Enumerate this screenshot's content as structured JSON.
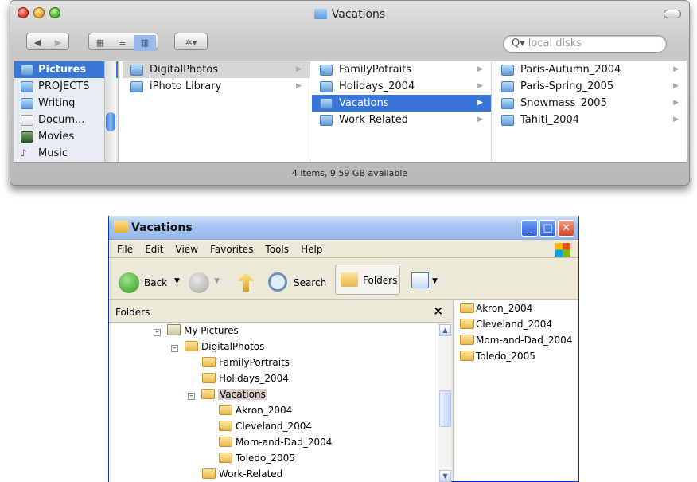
{
  "mac": {
    "title": "Vacations",
    "search_placeholder": "local disks",
    "status": "4 items, 9.59 GB available",
    "sidebar": [
      "Pictures",
      "PROJECTS",
      "Writing",
      "Docum...",
      "Movies",
      "Music"
    ],
    "col1": [
      "DigitalPhotos",
      "iPhoto Library"
    ],
    "col2": [
      "FamilyPotraits",
      "Holidays_2004",
      "Vacations",
      "Work-Related"
    ],
    "col3": [
      "Paris-Autumn_2004",
      "Paris-Spring_2005",
      "Snowmass_2005",
      "Tahiti_2004"
    ]
  },
  "xp": {
    "title": "Vacations",
    "menu": [
      "File",
      "Edit",
      "View",
      "Favorites",
      "Tools",
      "Help"
    ],
    "toolbar": {
      "back": "Back",
      "search": "Search",
      "folders": "Folders"
    },
    "folders_pane_title": "Folders",
    "close_glyph": "×",
    "tree": [
      "My Pictures",
      "DigitalPhotos",
      "FamilyPortraits",
      "Holidays_2004",
      "Vacations",
      "Akron_2004",
      "Cleveland_2004",
      "Mom-and-Dad_2004",
      "Toledo_2005",
      "Work-Related"
    ],
    "files": [
      "Akron_2004",
      "Cleveland_2004",
      "Mom-and-Dad_2004",
      "Toledo_2005"
    ]
  }
}
